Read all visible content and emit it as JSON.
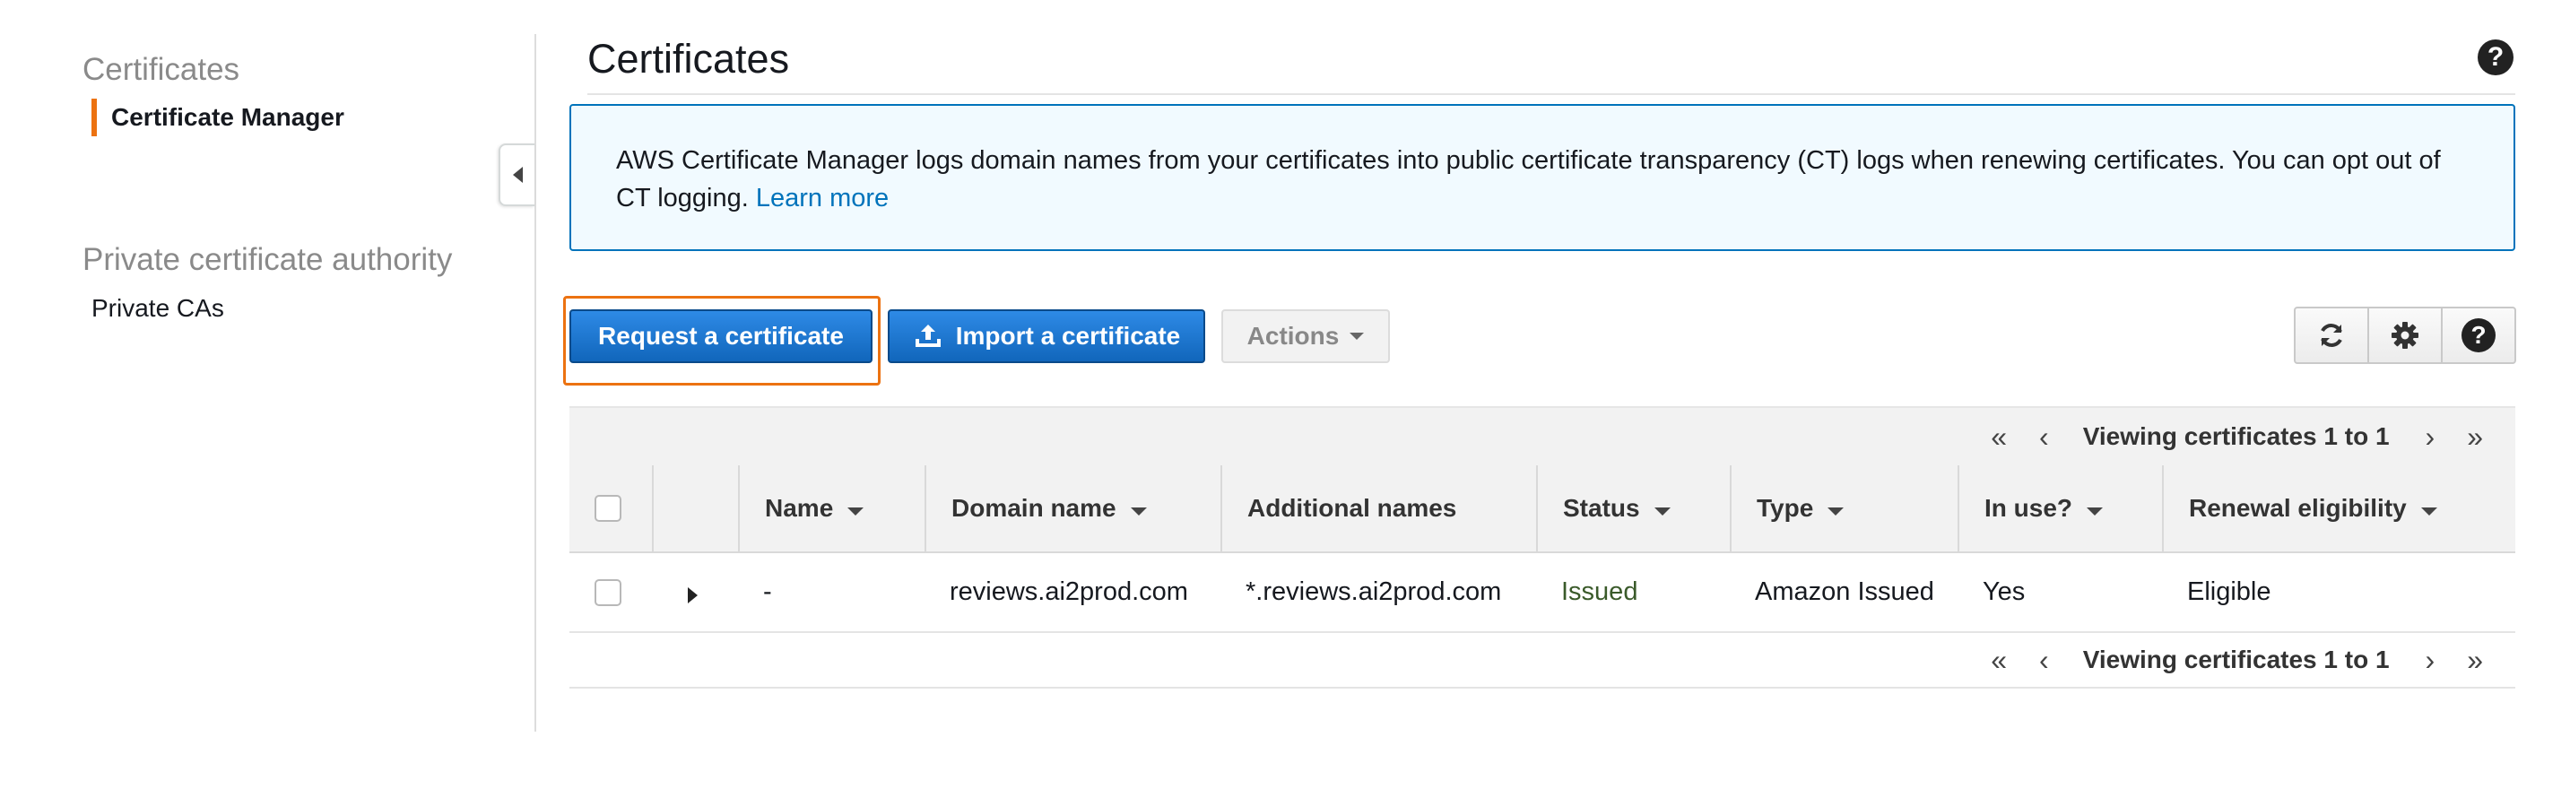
{
  "sidebar": {
    "sections": [
      {
        "heading": "Certificates",
        "items": [
          {
            "label": "Certificate Manager",
            "active": true
          }
        ]
      },
      {
        "heading": "Private certificate authority",
        "items": [
          {
            "label": "Private CAs",
            "active": false
          }
        ]
      }
    ]
  },
  "page": {
    "title": "Certificates"
  },
  "info": {
    "text": "AWS Certificate Manager logs domain names from your certificates into public certificate transparency (CT) logs when renewing certificates. You can opt out of CT logging.",
    "link_label": "Learn more"
  },
  "toolbar": {
    "request_label": "Request a certificate",
    "import_label": "Import a certificate",
    "actions_label": "Actions"
  },
  "pager": {
    "text": "Viewing certificates 1 to 1"
  },
  "table": {
    "columns": [
      "Name",
      "Domain name",
      "Additional names",
      "Status",
      "Type",
      "In use?",
      "Renewal eligibility"
    ],
    "rows": [
      {
        "name": "-",
        "domain": "reviews.ai2prod.com",
        "additional": "*.reviews.ai2prod.com",
        "status": "Issued",
        "type": "Amazon Issued",
        "in_use": "Yes",
        "renewal": "Eligible"
      }
    ]
  },
  "colors": {
    "accent_orange": "#ec7211",
    "primary_blue": "#1166bb",
    "link_blue": "#0073bb",
    "status_issued": "#3a5a2a"
  },
  "icons": [
    "collapse-left-icon",
    "help-icon",
    "upload-icon",
    "caret-down-icon",
    "refresh-icon",
    "gear-icon",
    "sort-desc-icon",
    "expand-right-icon",
    "first-page-icon",
    "prev-page-icon",
    "next-page-icon",
    "last-page-icon"
  ]
}
